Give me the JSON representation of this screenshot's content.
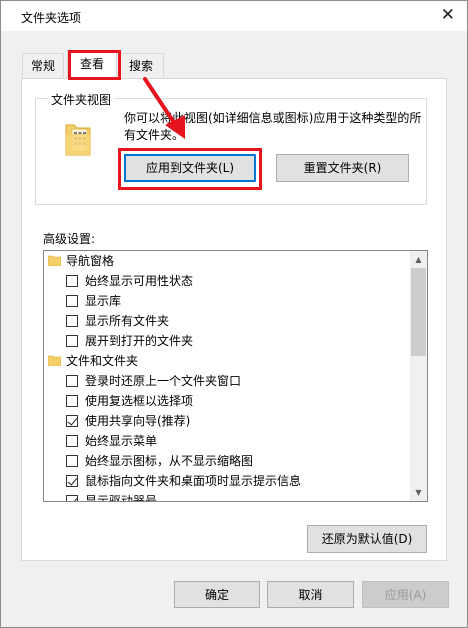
{
  "window": {
    "title": "文件夹选项",
    "close_glyph": "✕"
  },
  "tabs": [
    {
      "label": "常规",
      "selected": false
    },
    {
      "label": "查看",
      "selected": true
    },
    {
      "label": "搜索",
      "selected": false
    }
  ],
  "folder_views": {
    "group_title": "文件夹视图",
    "description": "你可以将此视图(如详细信息或图标)应用于这种类型的所有文件夹。",
    "apply_button": "应用到文件夹(L)",
    "reset_button": "重置文件夹(R)"
  },
  "advanced": {
    "label": "高级设置:",
    "items": [
      {
        "type": "folder",
        "label": "导航窗格"
      },
      {
        "type": "checkbox",
        "label": "始终显示可用性状态",
        "checked": false
      },
      {
        "type": "checkbox",
        "label": "显示库",
        "checked": false
      },
      {
        "type": "checkbox",
        "label": "显示所有文件夹",
        "checked": false
      },
      {
        "type": "checkbox",
        "label": "展开到打开的文件夹",
        "checked": false
      },
      {
        "type": "folder",
        "label": "文件和文件夹"
      },
      {
        "type": "checkbox",
        "label": "登录时还原上一个文件夹窗口",
        "checked": false
      },
      {
        "type": "checkbox",
        "label": "使用复选框以选择项",
        "checked": false
      },
      {
        "type": "checkbox",
        "label": "使用共享向导(推荐)",
        "checked": true
      },
      {
        "type": "checkbox",
        "label": "始终显示菜单",
        "checked": false
      },
      {
        "type": "checkbox",
        "label": "始终显示图标，从不显示缩略图",
        "checked": false
      },
      {
        "type": "checkbox",
        "label": "鼠标指向文件夹和桌面项时显示提示信息",
        "checked": true
      },
      {
        "type": "checkbox",
        "label": "显示驱动器号",
        "checked": true
      }
    ],
    "restore_button": "还原为默认值(D)"
  },
  "footer": {
    "ok": "确定",
    "cancel": "取消",
    "apply": "应用(A)"
  },
  "colors": {
    "highlight_red": "#e6141e",
    "focus_blue": "#0078d7",
    "folder_yellow": "#f5cf6a"
  }
}
